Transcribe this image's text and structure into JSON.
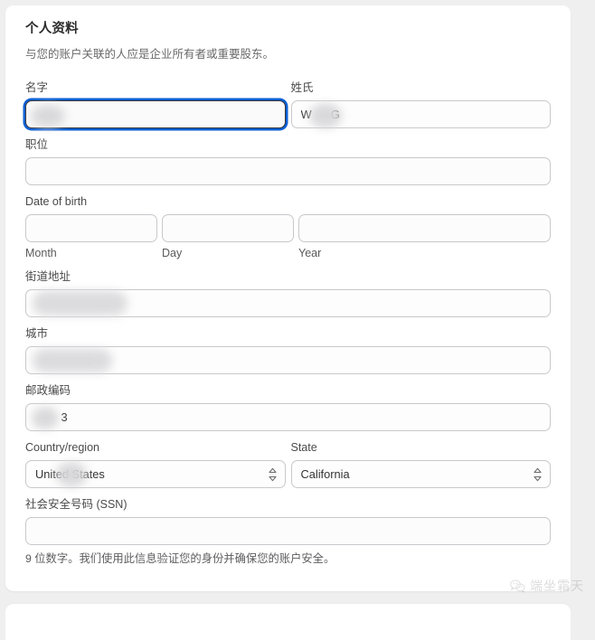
{
  "card": {
    "title": "个人资料",
    "subtitle": "与您的账户关联的人应是企业所有者或重要股东。"
  },
  "fields": {
    "first_name": {
      "label": "名字",
      "value": "",
      "placeholder": "",
      "focused": true,
      "redacted": true
    },
    "last_name": {
      "label": "姓氏",
      "value": "W      G",
      "placeholder": "",
      "focused": false,
      "redacted": true
    },
    "job_title": {
      "label": "职位",
      "value": "",
      "placeholder": "",
      "focused": false,
      "redacted": false
    },
    "date_of_birth": {
      "label": "Date of birth",
      "month": {
        "sub_label": "Month",
        "value": ""
      },
      "day": {
        "sub_label": "Day",
        "value": ""
      },
      "year": {
        "sub_label": "Year",
        "value": ""
      }
    },
    "street_address": {
      "label": "街道地址",
      "value": "                    et",
      "placeholder": "",
      "redacted": true
    },
    "city": {
      "label": "城市",
      "value": "                e",
      "placeholder": "",
      "redacted": true
    },
    "postal_code": {
      "label": "邮政编码",
      "value": "        3",
      "placeholder": "",
      "redacted": true
    },
    "country_region": {
      "label": "Country/region",
      "value": "United States",
      "redacted": true
    },
    "state": {
      "label": "State",
      "value": "California",
      "redacted": false
    },
    "ssn": {
      "label": "社会安全号码 (SSN)",
      "value": "",
      "placeholder": "",
      "helper": "9 位数字。我们使用此信息验证您的身份并确保您的账户安全。"
    }
  },
  "watermark": {
    "text": "端坐霜天",
    "icon": "wechat-icon"
  },
  "colors": {
    "focus_ring": "#0c5fd4",
    "card_bg": "#ffffff",
    "page_bg": "#efefef",
    "border": "#c9c9cd",
    "label_text": "#4a4a4a"
  }
}
